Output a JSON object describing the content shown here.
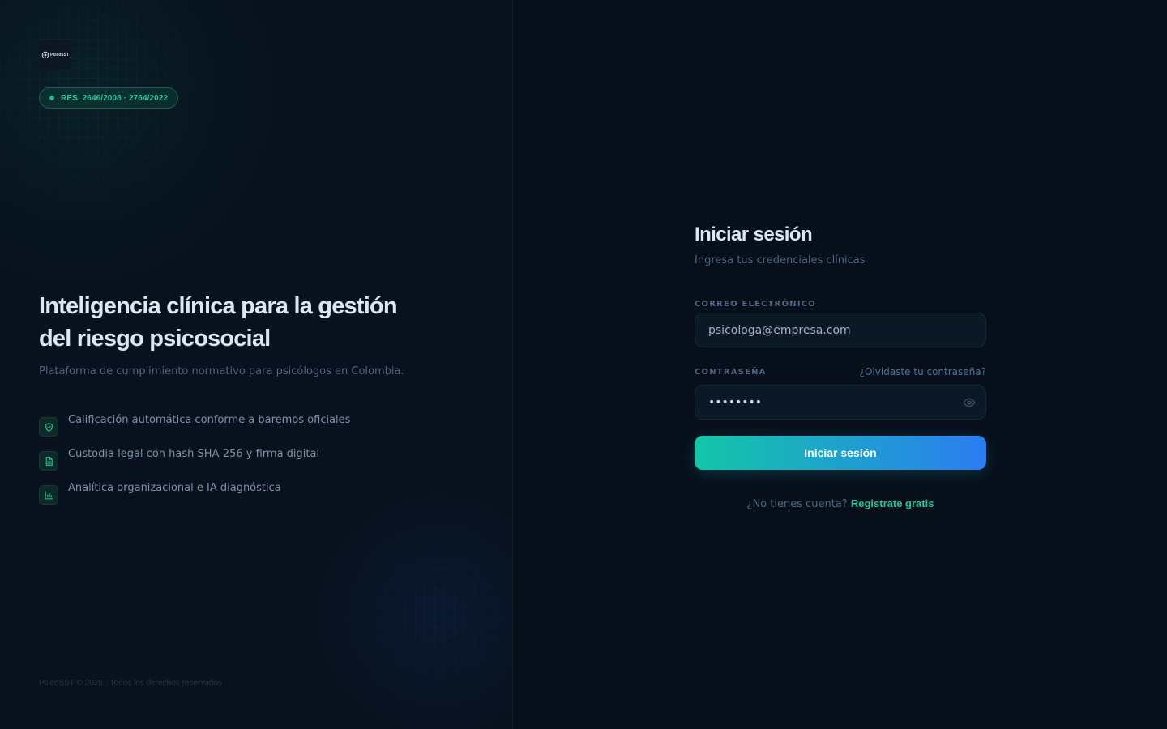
{
  "brand": {
    "logo_text": "PsicoSST",
    "logo_icon": "brain-network-icon"
  },
  "badge": {
    "text": "RES. 2646/2008 · 2764/2022",
    "color": "#2fc49a"
  },
  "hero": {
    "title": "Inteligencia clínica para la gestión del riesgo psicosocial",
    "subtitle": "Plataforma de cumplimiento normativo para psicólogos en Colombia."
  },
  "features": [
    {
      "icon": "shield-check-icon",
      "text": "Calificación automática conforme a baremos oficiales"
    },
    {
      "icon": "document-icon",
      "text": "Custodia legal con hash SHA-256 y firma digital"
    },
    {
      "icon": "bar-chart-icon",
      "text": "Analítica organizacional e IA diagnóstica"
    }
  ],
  "footer": {
    "text": "PsicoSST © 2026 · Todos los derechos reservados"
  },
  "login": {
    "title": "Iniciar sesión",
    "subtitle": "Ingresa tus credenciales clínicas",
    "email_label": "CORREO ELECTRÓNICO",
    "email_value": "psicologa@empresa.com",
    "password_label": "CONTRASEÑA",
    "forgot_link": "¿Olvidaste tu contraseña?",
    "password_masked": "••••••••",
    "show_password_icon": "eye-icon",
    "submit_label": "Iniciar sesión",
    "signup_prompt": "¿No tienes cuenta?",
    "signup_link": "Registrate gratis"
  },
  "colors": {
    "accent_teal": "#12c7a7",
    "accent_blue": "#2b7cf2",
    "background": "#070f1b"
  }
}
